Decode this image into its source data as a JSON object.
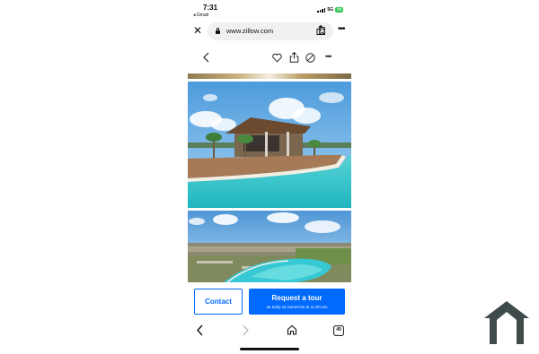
{
  "status_bar": {
    "time": "7:31",
    "back_app": "◂ Gmail",
    "network": "5G",
    "battery": "73"
  },
  "browser": {
    "url": "www.zillow.com",
    "tabs_count": "49"
  },
  "cta": {
    "contact_label": "Contact",
    "tour_label": "Request a tour",
    "tour_sub": "as early as tomorrow at 11:00 am"
  },
  "colors": {
    "brand_blue": "#006aff",
    "battery_green": "#34c759",
    "water": "#2fc3c9"
  }
}
